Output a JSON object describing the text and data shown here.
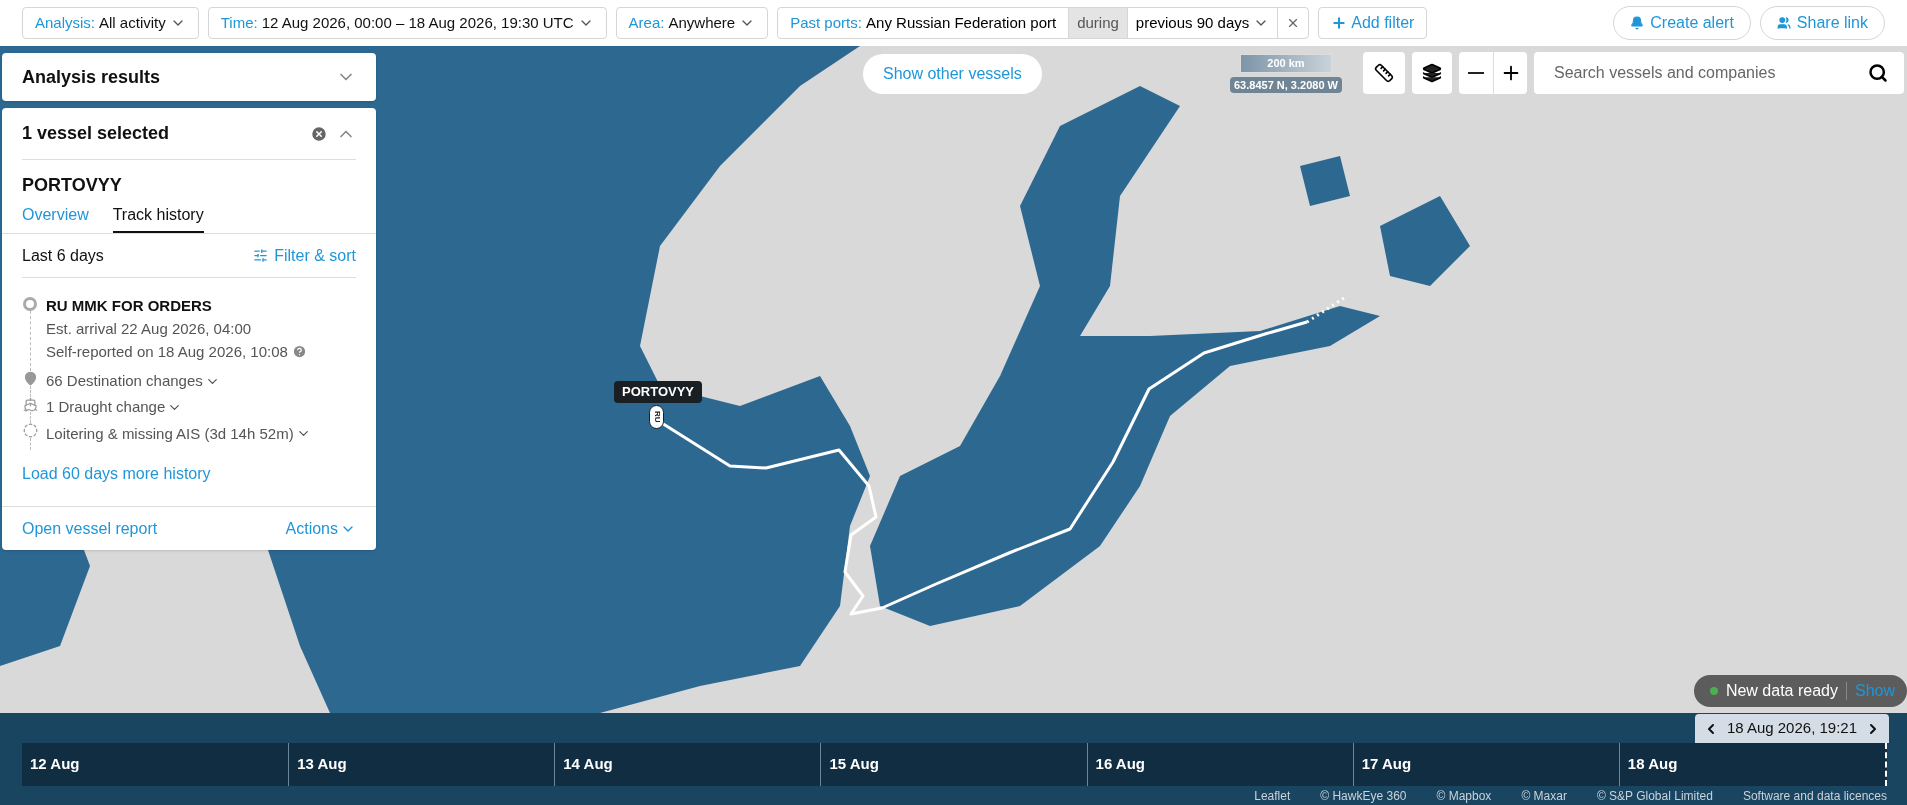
{
  "filters": [
    {
      "kind": "dropdown",
      "label": "Analysis:",
      "value": "All activity"
    },
    {
      "kind": "dropdown",
      "label": "Time:",
      "value": "12 Aug 2026, 00:00 – 18 Aug 2026, 19:30 UTC"
    },
    {
      "kind": "dropdown",
      "label": "Area:",
      "value": "Anywhere"
    },
    {
      "kind": "ports",
      "label": "Past ports:",
      "value": "Any Russian Federation port",
      "qualifier": "during",
      "period": "previous 90 days"
    }
  ],
  "add_filter": "Add filter",
  "actions": [
    {
      "kind": "alert",
      "label": "Create alert"
    },
    {
      "kind": "share",
      "label": "Share link"
    }
  ],
  "analysis_results": {
    "title": "Analysis results",
    "expanded": false
  },
  "selection": {
    "title": "1 vessel selected",
    "expanded": true,
    "vessel": "PORTOVYY",
    "tabs": [
      {
        "label": "Overview",
        "selected": false
      },
      {
        "label": "Track history",
        "selected": true
      }
    ],
    "range": "Last 6 days",
    "filter_sort": "Filter & sort",
    "events": [
      {
        "kind": "destination",
        "title": "RU MMK FOR ORDERS",
        "lines": [
          "Est. arrival 22 Aug 2026, 04:00",
          "Self-reported on 18 Aug 2026, 10:08"
        ]
      },
      {
        "kind": "destination_changes",
        "text": "66 Destination changes"
      },
      {
        "kind": "draught",
        "text": "1 Draught change"
      },
      {
        "kind": "loitering",
        "text": "Loitering & missing AIS (3d 14h 52m)"
      }
    ],
    "load_more": "Load 60 days more history",
    "report": "Open vessel report",
    "more_actions": "Actions"
  },
  "map": {
    "show_other": "Show other vessels",
    "scale": "200 km",
    "coords": "63.8457 N, 3.2080 W",
    "search": {
      "placeholder": "Search vessels and companies"
    },
    "vessel_label": "PORTOVYY",
    "flag": "RU"
  },
  "notification": {
    "text": "New data ready",
    "link": "Show"
  },
  "timeline": {
    "cursor": "18 Aug 2026, 19:21",
    "days": [
      "12 Aug",
      "13 Aug",
      "14 Aug",
      "15 Aug",
      "16 Aug",
      "17 Aug",
      "18 Aug"
    ]
  },
  "attribution": [
    "Leaflet",
    "© HawkEye 360",
    "© Mapbox",
    "© Maxar",
    "© S&P Global Limited",
    "Software and data licences"
  ]
}
